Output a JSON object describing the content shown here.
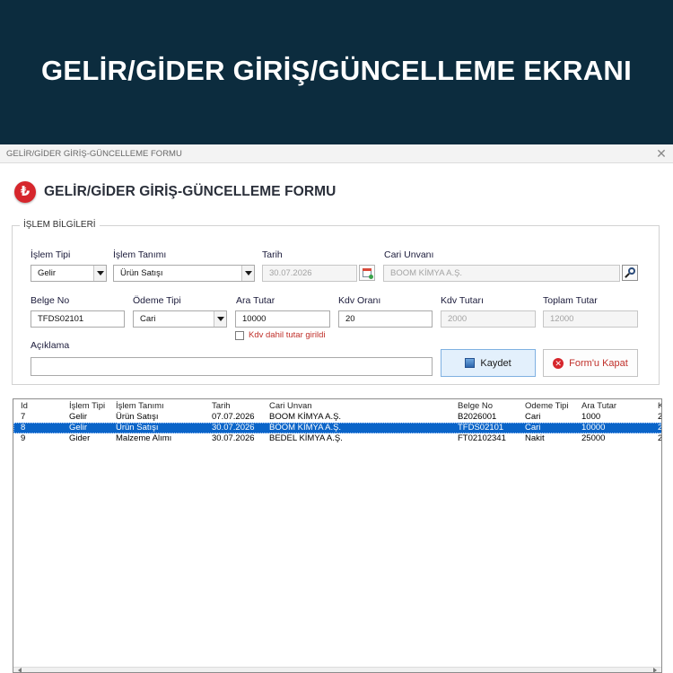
{
  "banner": {
    "title": "GELİR/GİDER GİRİŞ/GÜNCELLEME EKRANI"
  },
  "window": {
    "title": "GELİR/GİDER GİRİŞ-GÜNCELLEME FORMU",
    "close_glyph": "✕"
  },
  "form": {
    "icon_glyph": "₺",
    "heading": "GELİR/GİDER GİRİŞ-GÜNCELLEME FORMU",
    "group_title": "İŞLEM BİLGİLERİ",
    "labels": {
      "islem_tipi": "İşlem Tipi",
      "islem_tanimi": "İşlem Tanımı",
      "tarih": "Tarih",
      "cari_unvani": "Cari Unvanı",
      "belge_no": "Belge No",
      "odeme_tipi": "Ödeme Tipi",
      "ara_tutar": "Ara Tutar",
      "kdv_orani": "Kdv Oranı",
      "kdv_tutari": "Kdv Tutarı",
      "toplam_tutar": "Toplam Tutar",
      "aciklama": "Açıklama"
    },
    "values": {
      "islem_tipi": "Gelir",
      "islem_tanimi": "Ürün Satışı",
      "tarih": "30.07.2026",
      "cari_unvani": "BOOM KİMYA A.Ş.",
      "belge_no": "TFDS02101",
      "odeme_tipi": "Cari",
      "ara_tutar": "10000",
      "kdv_orani": "20",
      "kdv_tutari": "2000",
      "toplam_tutar": "12000",
      "aciklama": ""
    },
    "kdv_checkbox_label": "Kdv dahil tutar girildi",
    "kdv_checked": false,
    "buttons": {
      "save": "Kaydet",
      "close": "Form'u Kapat"
    },
    "icons": {
      "calendar": "calendar-icon",
      "search": "search-icon",
      "save": "save-icon",
      "close": "close-icon"
    }
  },
  "list": {
    "columns": [
      "Id",
      "İşlem Tipi",
      "İşlem Tanımı",
      "Tarih",
      "Cari Unvan",
      "Belge No",
      "Odeme Tipi",
      "Ara Tutar",
      "K"
    ],
    "rows": [
      [
        "7",
        "Gelir",
        "Ürün Satışı",
        "07.07.2026",
        "BOOM KİMYA A.Ş.",
        "B2026001",
        "Cari",
        "1000",
        "2"
      ],
      [
        "8",
        "Gelir",
        "Ürün Satışı",
        "30.07.2026",
        "BOOM KİMYA A.Ş.",
        "TFDS02101",
        "Cari",
        "10000",
        "2"
      ],
      [
        "9",
        "Gider",
        "Malzeme Alımı",
        "30.07.2026",
        "BEDEL KİMYA A.Ş.",
        "FT02102341",
        "Nakit",
        "25000",
        "2"
      ]
    ],
    "selected_row_index": 1
  },
  "colors": {
    "banner_bg": "#0c2c3e",
    "accent_red": "#d6262c",
    "selection_blue": "#0a64c8",
    "save_button_bg": "#e3f0fc"
  }
}
